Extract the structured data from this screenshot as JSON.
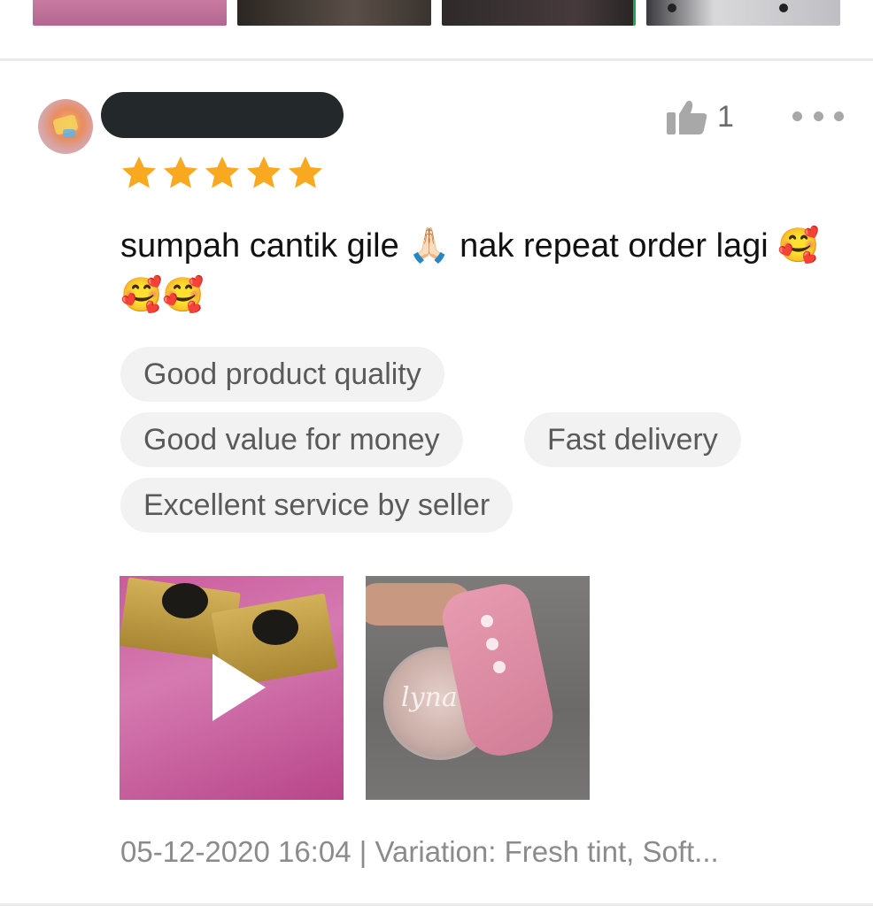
{
  "review": {
    "like_count": "1",
    "rating": 5,
    "rating_max": 5,
    "text_part1": "sumpah cantik gile ",
    "emoji_pray": "🙏🏻",
    "text_part2": " nak repeat order lagi ",
    "emoji_hearts": "🥰🥰🥰",
    "tags": [
      "Good product quality",
      "Good value for money",
      "Fast delivery",
      "Excellent service by seller"
    ],
    "media_overlay_text": "lyna",
    "meta": "05-12-2020 16:04 | Variation: Fresh tint, Soft..."
  },
  "colors": {
    "star": "#f8a91f",
    "icon_gray": "#a8a8a8",
    "tag_bg": "#f2f2f2",
    "username_mask": "#23282b"
  },
  "icons": {
    "like": "thumbs-up-icon",
    "more": "more-dots-icon",
    "star": "star-icon",
    "play": "play-icon"
  }
}
